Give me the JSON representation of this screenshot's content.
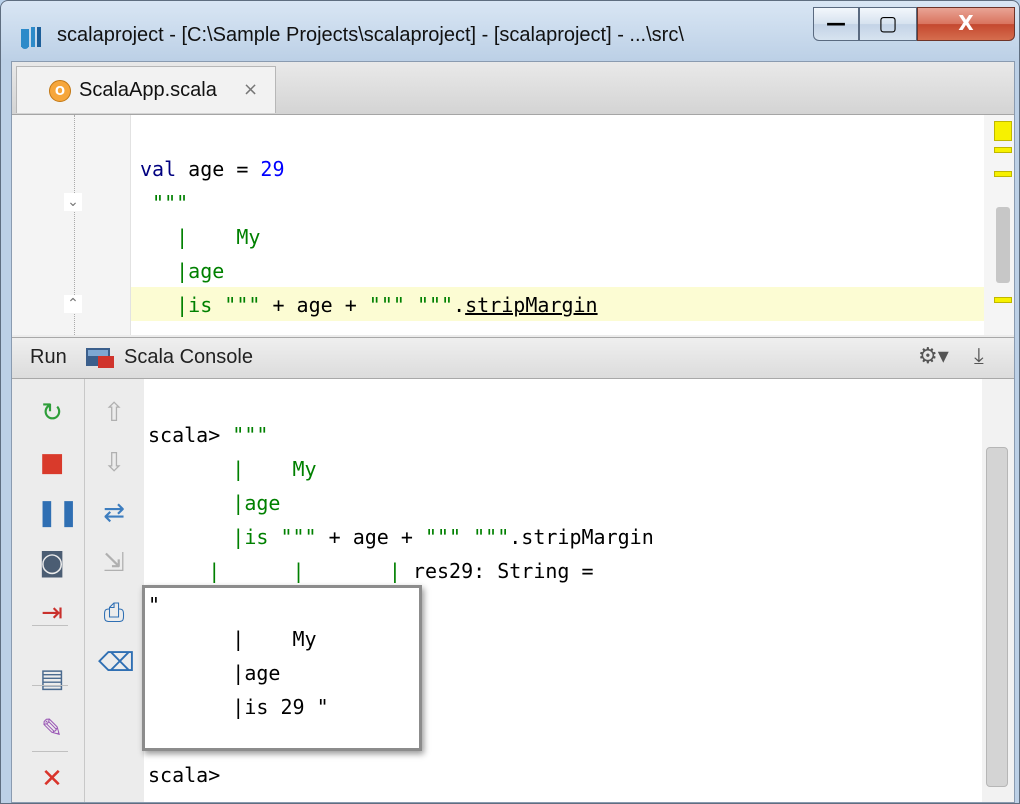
{
  "window": {
    "title": "scalaproject - [C:\\Sample Projects\\scalaproject] - [scalaproject] - ...\\src\\",
    "min_glyph": "—",
    "max_glyph": "▢",
    "close_glyph": "X"
  },
  "tabs": [
    {
      "label": "ScalaApp.scala",
      "icon": "scala-object-icon",
      "icon_glyph": "O",
      "close_glyph": "×"
    }
  ],
  "editor": {
    "lines": [
      {
        "parts": [
          {
            "t": "val",
            "c": "kw"
          },
          {
            "t": " age = ",
            "c": ""
          },
          {
            "t": "29",
            "c": "num"
          }
        ]
      },
      {
        "parts": [
          {
            "t": " \"\"\"",
            "c": "str"
          }
        ]
      },
      {
        "parts": [
          {
            "t": "   |    My",
            "c": "str"
          }
        ]
      },
      {
        "parts": [
          {
            "t": "   |age",
            "c": "str"
          }
        ]
      },
      {
        "parts": [
          {
            "t": "   |is \"\"\"",
            "c": "str"
          },
          {
            "t": " + age + ",
            "c": ""
          },
          {
            "t": "\"\"\" \"\"\"",
            "c": "str"
          },
          {
            "t": ".",
            "c": ""
          },
          {
            "t": "stripMargin",
            "c": "und"
          }
        ]
      }
    ]
  },
  "run_panel": {
    "run_label": "Run",
    "console_label": "Scala Console",
    "gear_glyph": "⚙▾",
    "pin_glyph": "⤓"
  },
  "console": {
    "lines": [
      {
        "parts": [
          {
            "t": "scala> ",
            "c": ""
          },
          {
            "t": "\"\"\"",
            "c": "str"
          }
        ]
      },
      {
        "parts": [
          {
            "t": "       |    My",
            "c": "str"
          }
        ]
      },
      {
        "parts": [
          {
            "t": "       |age",
            "c": "str"
          }
        ]
      },
      {
        "parts": [
          {
            "t": "       |is \"\"\"",
            "c": "str"
          },
          {
            "t": " + age + ",
            "c": ""
          },
          {
            "t": "\"\"\" \"\"\"",
            "c": "str"
          },
          {
            "t": ".stripMargin",
            "c": ""
          }
        ]
      },
      {
        "parts": [
          {
            "t": "     |      |       |",
            "c": "str"
          },
          {
            "t": " res29: String =",
            "c": ""
          }
        ]
      },
      {
        "parts": [
          {
            "t": "\"",
            "c": ""
          }
        ]
      },
      {
        "parts": [
          {
            "t": "       |    My",
            "c": ""
          }
        ]
      },
      {
        "parts": [
          {
            "t": "       |age",
            "c": ""
          }
        ]
      },
      {
        "parts": [
          {
            "t": "       |is 29 \"",
            "c": ""
          }
        ]
      },
      {
        "parts": [
          {
            "t": "",
            "c": ""
          }
        ]
      },
      {
        "parts": [
          {
            "t": "scala>",
            "c": ""
          }
        ]
      }
    ]
  },
  "toolbar_left": [
    {
      "name": "rerun-icon",
      "glyph": "↻",
      "color": "#2e9e3a"
    },
    {
      "name": "stop-icon",
      "glyph": "■",
      "color": "#d93a2b"
    },
    {
      "name": "pause-icon",
      "glyph": "❚❚",
      "color": "#2f6fb3"
    },
    {
      "name": "camera-icon",
      "glyph": "◙",
      "color": "#4b5d73"
    },
    {
      "name": "exit-icon",
      "glyph": "⇥",
      "color": "#c9302c"
    },
    {
      "name": "layout-icon",
      "glyph": "▤",
      "color": "#4b6b8f"
    },
    {
      "name": "pin-icon",
      "glyph": "✎",
      "color": "#9b59b6"
    },
    {
      "name": "close-icon",
      "glyph": "✕",
      "color": "#d9342b"
    }
  ],
  "toolbar_mid": [
    {
      "name": "scroll-up-icon",
      "glyph": "⇧",
      "color": "#b0b0b0"
    },
    {
      "name": "scroll-down-icon",
      "glyph": "⇩",
      "color": "#b0b0b0"
    },
    {
      "name": "soft-wrap-icon",
      "glyph": "⇄",
      "color": "#3d7dbf"
    },
    {
      "name": "export-icon",
      "glyph": "⇲",
      "color": "#b0b0b0"
    },
    {
      "name": "print-icon",
      "glyph": "⎙",
      "color": "#2f6fb3"
    },
    {
      "name": "trash-icon",
      "glyph": "⌫",
      "color": "#2f6fb3"
    }
  ]
}
